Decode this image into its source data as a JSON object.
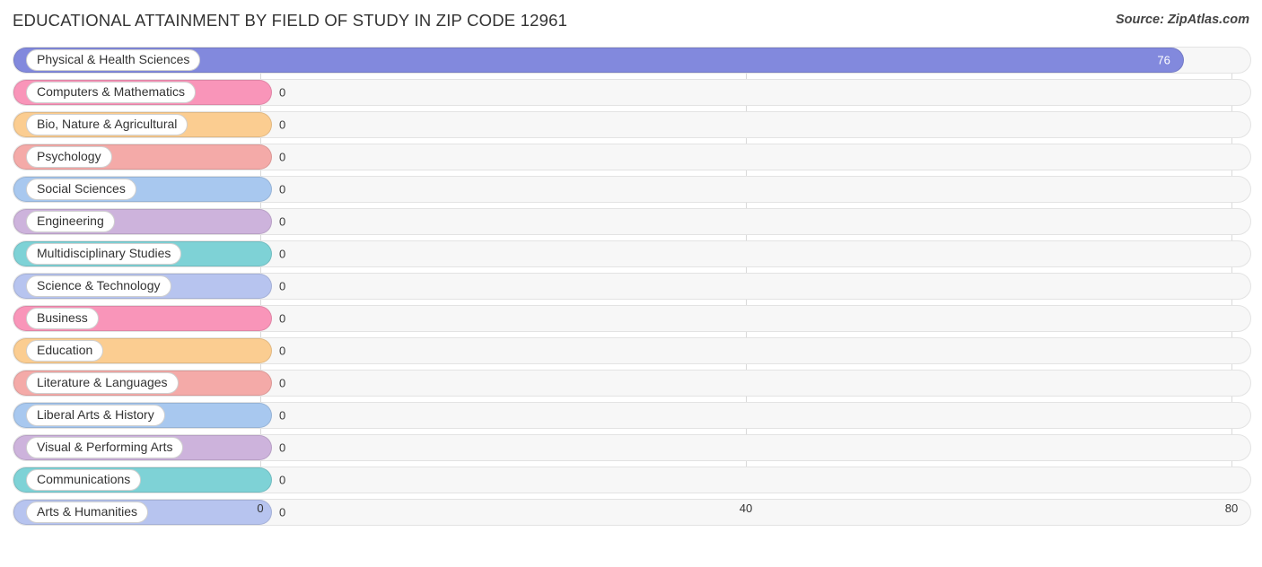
{
  "header": {
    "title": "EDUCATIONAL ATTAINMENT BY FIELD OF STUDY IN ZIP CODE 12961",
    "source": "Source: ZipAtlas.com"
  },
  "chart_data": {
    "type": "bar",
    "orientation": "horizontal",
    "title": "EDUCATIONAL ATTAINMENT BY FIELD OF STUDY IN ZIP CODE 12961",
    "xlabel": "",
    "ylabel": "",
    "xlim": [
      0,
      80
    ],
    "xticks": [
      "0",
      "40",
      "80"
    ],
    "grid": true,
    "legend": false,
    "categories": [
      "Physical & Health Sciences",
      "Computers & Mathematics",
      "Bio, Nature & Agricultural",
      "Psychology",
      "Social Sciences",
      "Engineering",
      "Multidisciplinary Studies",
      "Science & Technology",
      "Business",
      "Education",
      "Literature & Languages",
      "Liberal Arts & History",
      "Visual & Performing Arts",
      "Communications",
      "Arts & Humanities"
    ],
    "values": [
      76,
      0,
      0,
      0,
      0,
      0,
      0,
      0,
      0,
      0,
      0,
      0,
      0,
      0,
      0
    ],
    "value_labels": [
      "76",
      "0",
      "0",
      "0",
      "0",
      "0",
      "0",
      "0",
      "0",
      "0",
      "0",
      "0",
      "0",
      "0",
      "0"
    ],
    "bar_colors": [
      "#8289dd",
      "#f995b9",
      "#fbcd91",
      "#f4aaa8",
      "#a8c8ef",
      "#cdb3dc",
      "#7ed2d6",
      "#b7c4ef",
      "#f995b9",
      "#fbcd91",
      "#f4aaa8",
      "#a8c8ef",
      "#cdb3dc",
      "#7ed2d6",
      "#b7c4ef"
    ]
  }
}
